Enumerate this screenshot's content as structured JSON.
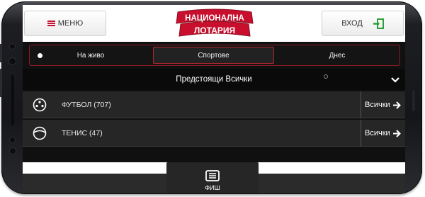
{
  "header": {
    "menu_label": "МЕНЮ",
    "logo_line1": "НАЦИОНАЛНА",
    "logo_line2": "ЛОТАРИЯ",
    "login_label": "ВХОД"
  },
  "tabs": [
    {
      "label": "На живо"
    },
    {
      "label": "Спортове"
    },
    {
      "label": "Днес"
    }
  ],
  "subheader": "Предстоящи Всички",
  "sports": [
    {
      "label": "ФУТБОЛ (707)",
      "all": "Всички",
      "icon": "soccer-ball-icon"
    },
    {
      "label": "ТЕНИС (47)",
      "all": "Всички",
      "icon": "tennis-ball-icon"
    }
  ],
  "bottom": {
    "fish_label": "ФИШ",
    "icon": "betslip-icon"
  },
  "colors": {
    "accent": "#c8102e",
    "green": "#2e9e3b",
    "dark": "#101010"
  }
}
